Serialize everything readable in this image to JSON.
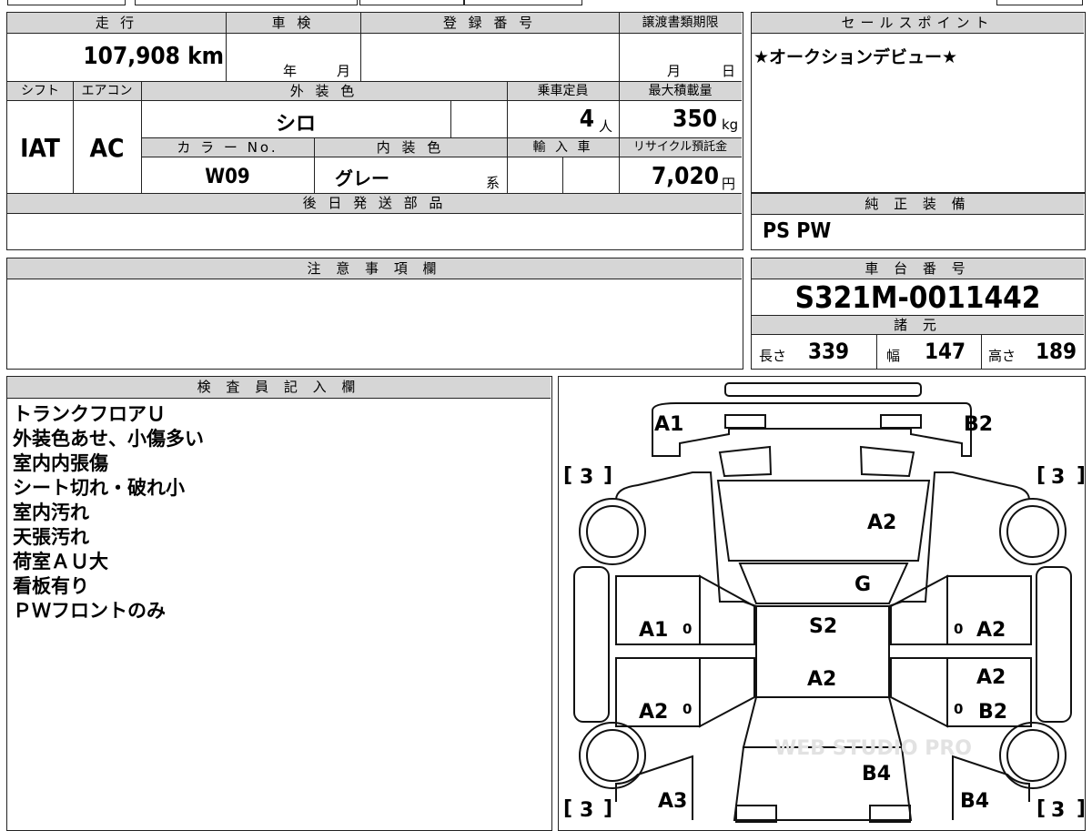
{
  "header": {
    "mileage_label": "走 行",
    "shaken_label": "車 検",
    "reg_label": "登 録 番 号",
    "transfer_label": "譲渡書類期限",
    "mileage": "107,908 km",
    "year_unit": "年",
    "month_unit": "月",
    "transfer_month": "月",
    "transfer_day": "日"
  },
  "specs": {
    "shift_label": "シフト",
    "ac_label": "エアコン",
    "exterior_label": "外 装 色",
    "capacity_label": "乗車定員",
    "maxload_label": "最大積載量",
    "shift": "IAT",
    "ac": "AC",
    "exterior": "シロ",
    "capacity": "4",
    "capacity_unit": "人",
    "maxload": "350",
    "maxload_unit": "kg",
    "colorno_label": "カ ラ ー No.",
    "interior_label": "内 装 色",
    "import_label": "輸 入 車",
    "recycle_label": "リサイクル預託金",
    "colorno": "W09",
    "interior": "グレー",
    "interior_unit": "系",
    "recycle": "7,020",
    "recycle_unit": "円"
  },
  "later_parts": {
    "label": "後 日 発 送 部 品",
    "value": ""
  },
  "sales_point": {
    "label": "セールスポイント",
    "text": "★オークションデビュー★"
  },
  "equipment": {
    "label": "純 正 装 備",
    "text": "PS PW"
  },
  "caution": {
    "label": "注 意 事 項 欄",
    "text": ""
  },
  "chassis": {
    "label": "車 台 番 号",
    "number": "S321M-0011442",
    "dims_label": "諸 元",
    "length_label": "長さ",
    "length": "339",
    "width_label": "幅",
    "width": "147",
    "height_label": "高さ",
    "height": "189"
  },
  "inspector": {
    "label": "検 査 員 記 入 欄",
    "notes": [
      "トランクフロアＵ",
      "外装色あせ、小傷多い",
      "室内内張傷",
      "シート切れ・破れ小",
      "室内汚れ",
      "天張汚れ",
      "荷室ＡＵ大",
      "看板有り",
      "ＰＷフロントのみ"
    ]
  },
  "diagram": {
    "marks": [
      "A1",
      "B2",
      "A2",
      "G",
      "S2",
      "A1",
      "A2",
      "A2",
      "A2",
      "A2",
      "B2",
      "B4",
      "A3",
      "B4"
    ],
    "tires": [
      "3",
      "3",
      "3",
      "3"
    ],
    "zeros": [
      "0",
      "0",
      "0",
      "0"
    ],
    "watermark": "WEB STUDIO PRO"
  }
}
